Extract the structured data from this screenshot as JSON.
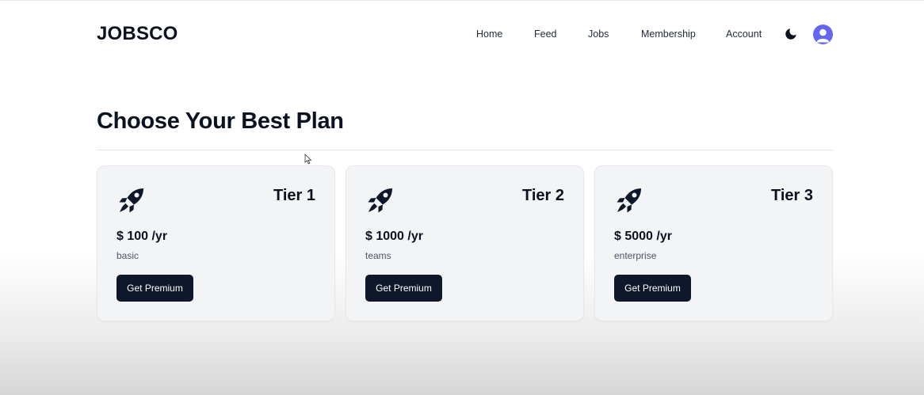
{
  "header": {
    "logo": "JOBSCO",
    "nav": [
      {
        "label": "Home"
      },
      {
        "label": "Feed"
      },
      {
        "label": "Jobs"
      },
      {
        "label": "Membership"
      },
      {
        "label": "Account"
      }
    ],
    "theme_icon": "moon-icon",
    "avatar_icon": "user-avatar-icon"
  },
  "main": {
    "title": "Choose Your Best Plan",
    "plans": [
      {
        "tier": "Tier 1",
        "price": "$ 100 /yr",
        "description": "basic",
        "button_label": "Get Premium",
        "icon": "rocket-icon"
      },
      {
        "tier": "Tier 2",
        "price": "$ 1000 /yr",
        "description": "teams",
        "button_label": "Get Premium",
        "icon": "rocket-icon"
      },
      {
        "tier": "Tier 3",
        "price": "$ 5000 /yr",
        "description": "enterprise",
        "button_label": "Get Premium",
        "icon": "rocket-icon"
      }
    ]
  },
  "colors": {
    "primary": "#0f172a",
    "avatar": "#6366f1",
    "card_bg": "#f3f4f6"
  }
}
